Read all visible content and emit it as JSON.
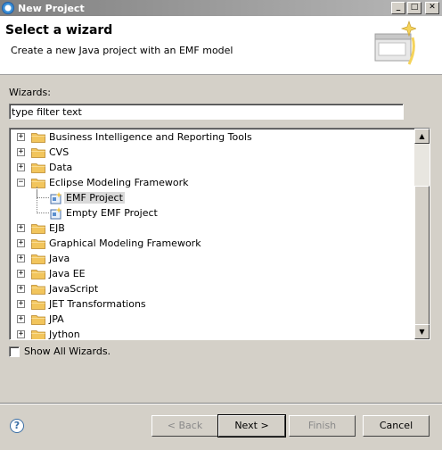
{
  "window": {
    "title": "New Project"
  },
  "header": {
    "title": "Select a wizard",
    "description": "Create a new Java project with an EMF model"
  },
  "wizards": {
    "label": "Wizards:",
    "filter_value": "type filter text"
  },
  "tree": {
    "items": [
      {
        "label": "Business Intelligence and Reporting Tools",
        "type": "folder",
        "expanded": false
      },
      {
        "label": "CVS",
        "type": "folder",
        "expanded": false
      },
      {
        "label": "Data",
        "type": "folder",
        "expanded": false
      },
      {
        "label": "Eclipse Modeling Framework",
        "type": "folder",
        "expanded": true
      },
      {
        "label": "EMF Project",
        "type": "leaf",
        "selected": true
      },
      {
        "label": "Empty EMF Project",
        "type": "leaf",
        "selected": false
      },
      {
        "label": "EJB",
        "type": "folder",
        "expanded": false
      },
      {
        "label": "Graphical Modeling Framework",
        "type": "folder",
        "expanded": false
      },
      {
        "label": "Java",
        "type": "folder",
        "expanded": false
      },
      {
        "label": "Java EE",
        "type": "folder",
        "expanded": false
      },
      {
        "label": "JavaScript",
        "type": "folder",
        "expanded": false
      },
      {
        "label": "JET Transformations",
        "type": "folder",
        "expanded": false
      },
      {
        "label": "JPA",
        "type": "folder",
        "expanded": false
      },
      {
        "label": "Jython",
        "type": "folder",
        "expanded": false
      }
    ]
  },
  "show_all": {
    "label": "Show All Wizards.",
    "checked": false
  },
  "buttons": {
    "help": "?",
    "back": "< Back",
    "next": "Next >",
    "finish": "Finish",
    "cancel": "Cancel"
  },
  "colors": {
    "selection": "#d9d9d9",
    "folder": "#f2c55c",
    "titlebar": "#808080"
  }
}
